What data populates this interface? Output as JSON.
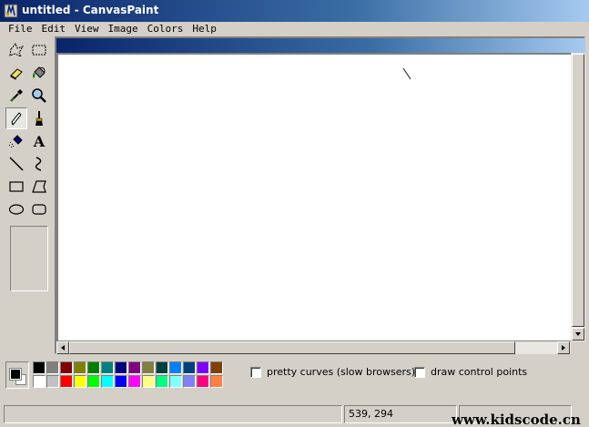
{
  "window": {
    "title": "untitled - CanvasPaint"
  },
  "menu": {
    "items": [
      "File",
      "Edit",
      "View",
      "Image",
      "Colors",
      "Help"
    ]
  },
  "toolbox": {
    "tools": [
      {
        "name": "free-select-icon"
      },
      {
        "name": "rect-select-icon"
      },
      {
        "name": "eraser-icon"
      },
      {
        "name": "fill-bucket-icon"
      },
      {
        "name": "color-picker-icon"
      },
      {
        "name": "magnifier-icon"
      },
      {
        "name": "pencil-icon",
        "active": true
      },
      {
        "name": "brush-icon"
      },
      {
        "name": "airbrush-icon"
      },
      {
        "name": "text-icon",
        "glyph": "A"
      },
      {
        "name": "line-icon"
      },
      {
        "name": "curve-icon"
      },
      {
        "name": "rectangle-icon"
      },
      {
        "name": "polygon-icon"
      },
      {
        "name": "ellipse-icon"
      },
      {
        "name": "rounded-rect-icon"
      }
    ]
  },
  "colors": {
    "foreground": "#000000",
    "background": "#ffffff",
    "palette_top": [
      "#000000",
      "#808080",
      "#800000",
      "#808000",
      "#008000",
      "#008080",
      "#000080",
      "#800080",
      "#808040",
      "#004040",
      "#0080ff",
      "#004080",
      "#8000ff",
      "#804000"
    ],
    "palette_bottom": [
      "#ffffff",
      "#c0c0c0",
      "#ff0000",
      "#ffff00",
      "#00ff00",
      "#00ffff",
      "#0000ff",
      "#ff00ff",
      "#ffff80",
      "#00ff80",
      "#80ffff",
      "#8080ff",
      "#ff0080",
      "#ff8040"
    ]
  },
  "options": {
    "pretty_curves_label": "pretty curves (slow browsers)",
    "pretty_curves_checked": false,
    "control_points_label": "draw control points",
    "control_points_checked": false
  },
  "status": {
    "message": "",
    "coordinates": "539, 294"
  },
  "watermark": "www.kidscode.cn"
}
